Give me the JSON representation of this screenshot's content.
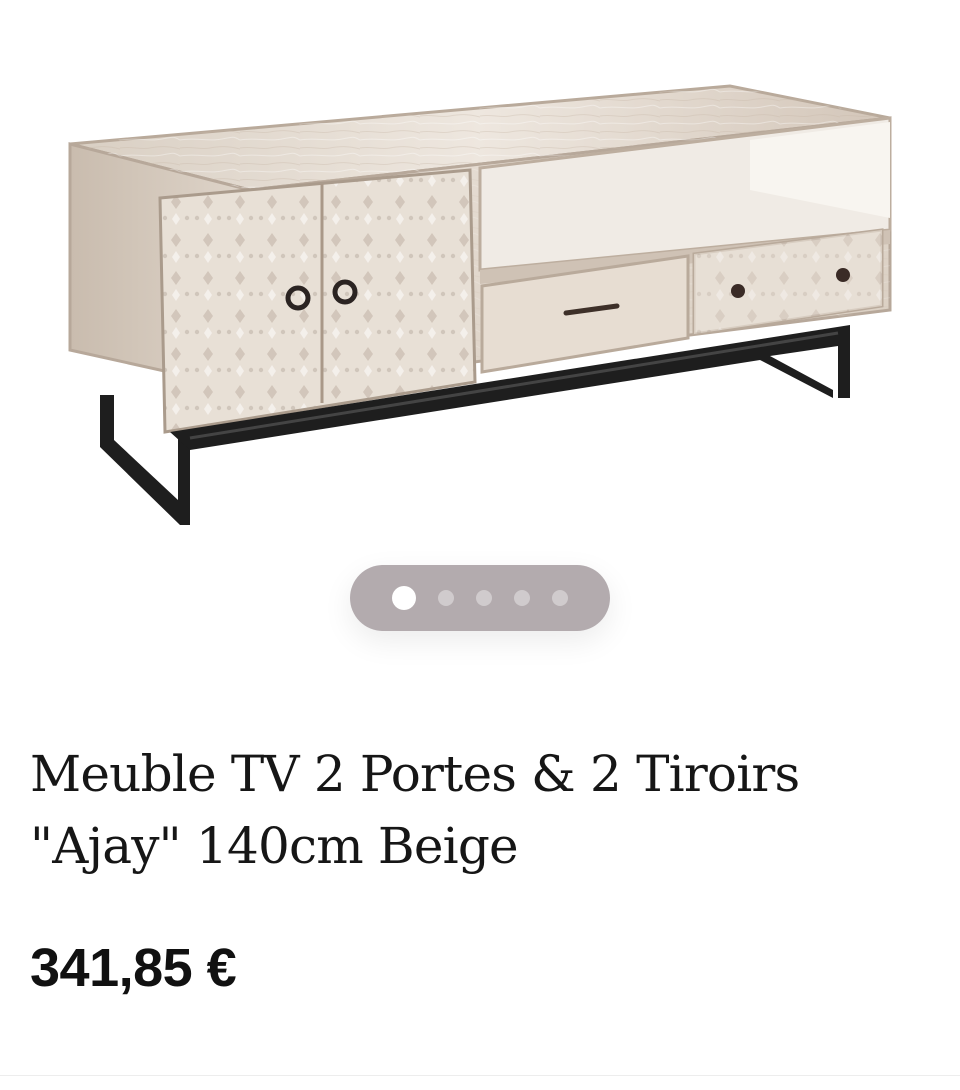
{
  "product": {
    "title_line_1": "Meuble TV 2 Portes & 2 Tiroirs",
    "title_line_2": "\"Ajay\" 140cm Beige",
    "price": "341,85 €"
  },
  "gallery": {
    "dots_total": 5,
    "active_dot_index": 0,
    "icons": {
      "carousel": "dot"
    }
  },
  "colors": {
    "wood_light": "#e9dfd4",
    "wood_shadow": "#c9bcae",
    "metal": "#1e1e1e",
    "dots_background": "#a2999c",
    "text": "#111111"
  }
}
